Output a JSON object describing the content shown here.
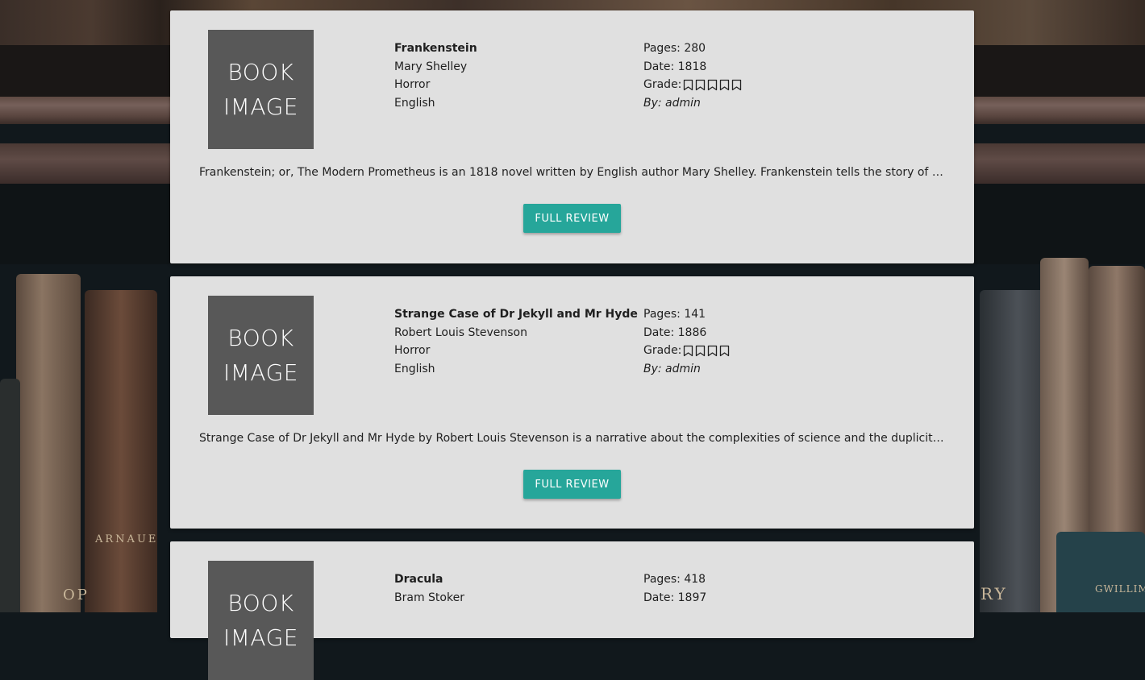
{
  "cards": [
    {
      "image_text_line1": "BOOK",
      "image_text_line2": "IMAGE",
      "title": "Frankenstein",
      "author": "Mary Shelley",
      "genre": "Horror",
      "language": "English",
      "pages": "Pages: 280",
      "date": "Date: 1818",
      "grade_label": "Grade:",
      "grade": 5,
      "by": "By: admin",
      "description": "Frankenstein; or, The Modern Prometheus is an 1818 novel written by English author Mary Shelley. Frankenstein tells the story of Victor Fran...",
      "button_label": "FULL REVIEW"
    },
    {
      "image_text_line1": "BOOK",
      "image_text_line2": "IMAGE",
      "title": "Strange Case of Dr Jekyll and Mr Hyde",
      "author": "Robert Louis Stevenson",
      "genre": "Horror",
      "language": "English",
      "pages": "Pages: 141",
      "date": "Date: 1886",
      "grade_label": "Grade:",
      "grade": 4,
      "by": "By: admin",
      "description": "Strange Case of Dr Jekyll and Mr Hyde by Robert Louis Stevenson is a narrative about the complexities of science and the duplicity of hum...",
      "button_label": "FULL REVIEW"
    },
    {
      "image_text_line1": "BOOK",
      "image_text_line2": "IMAGE",
      "title": "Dracula",
      "author": "Bram Stoker",
      "pages": "Pages: 418",
      "date": "Date: 1897"
    }
  ],
  "background_spines": [
    "ARNAUE",
    "OP",
    "RY",
    "GWILLIM"
  ],
  "colors": {
    "card_bg": "#e0e0e0",
    "image_bg": "#585858",
    "button_bg": "#26a69a",
    "button_text": "#ffffff"
  },
  "icons": {
    "grade": "bookmark-outline-icon"
  }
}
